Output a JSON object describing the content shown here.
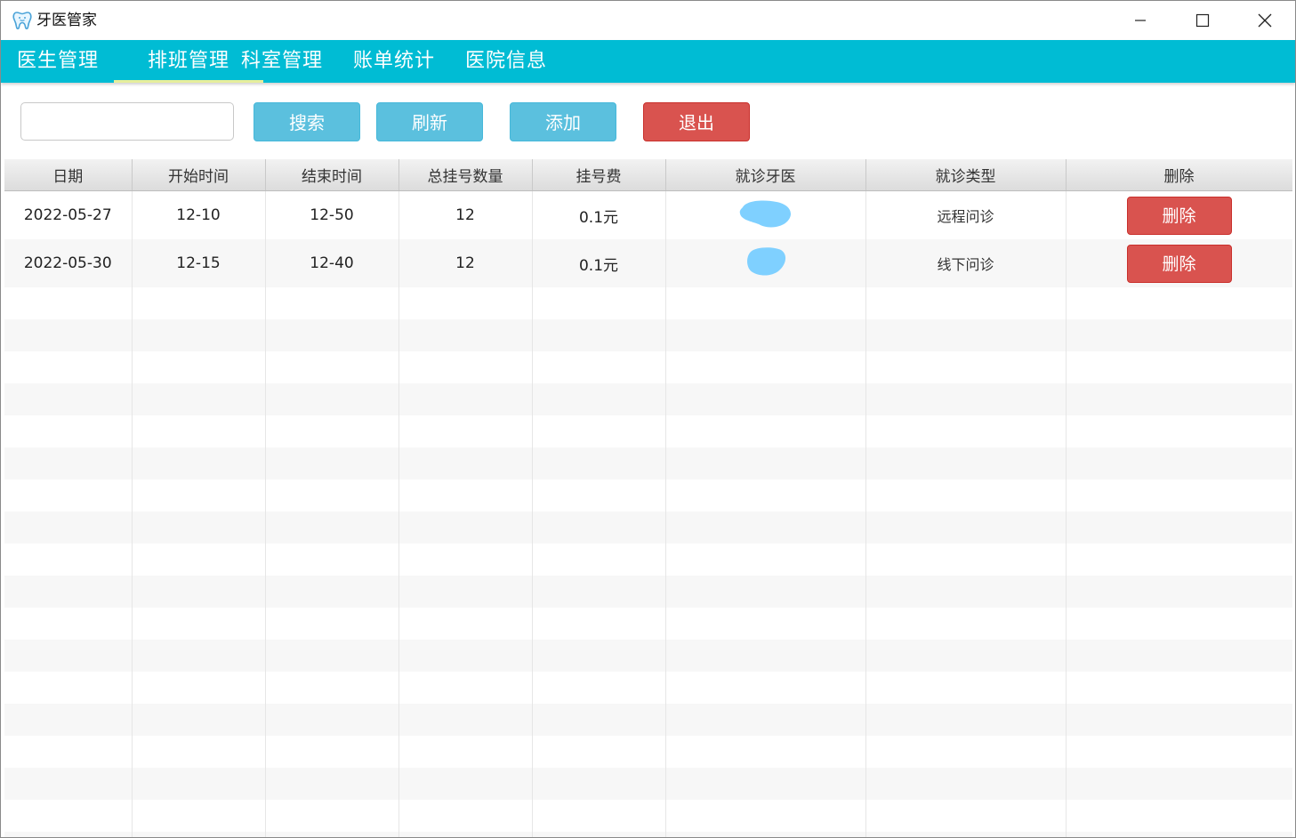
{
  "window": {
    "title": "牙医管家",
    "controls": [
      "minimize-icon",
      "maximize-icon",
      "close-icon"
    ]
  },
  "nav": {
    "items": [
      {
        "label": "医生管理",
        "active": false
      },
      {
        "label": "排班管理",
        "active": true
      },
      {
        "label": "科室管理",
        "active": false
      },
      {
        "label": "账单统计",
        "active": false
      },
      {
        "label": "医院信息",
        "active": false
      }
    ]
  },
  "toolbar": {
    "search_value": "",
    "search_label": "搜索",
    "refresh_label": "刷新",
    "add_label": "添加",
    "exit_label": "退出"
  },
  "table": {
    "headers": [
      "日期",
      "开始时间",
      "结束时间",
      "总挂号数量",
      "挂号费",
      "就诊牙医",
      "就诊类型",
      "删除"
    ],
    "rows": [
      {
        "date": "2022-05-27",
        "start": "12-10",
        "end": "12-50",
        "total": "12",
        "fee": "0.1元",
        "type": "远程问诊",
        "delete_label": "删除"
      },
      {
        "date": "2022-05-30",
        "start": "12-15",
        "end": "12-40",
        "total": "12",
        "fee": "0.1元",
        "type": "线下问诊",
        "delete_label": "删除"
      }
    ]
  },
  "colors": {
    "nav_bg": "#00bcd4",
    "active_underline": "#e6ee9c",
    "btn_blue": "#5bc0de",
    "btn_red": "#d9534f",
    "redaction": "#7fd0ff"
  }
}
